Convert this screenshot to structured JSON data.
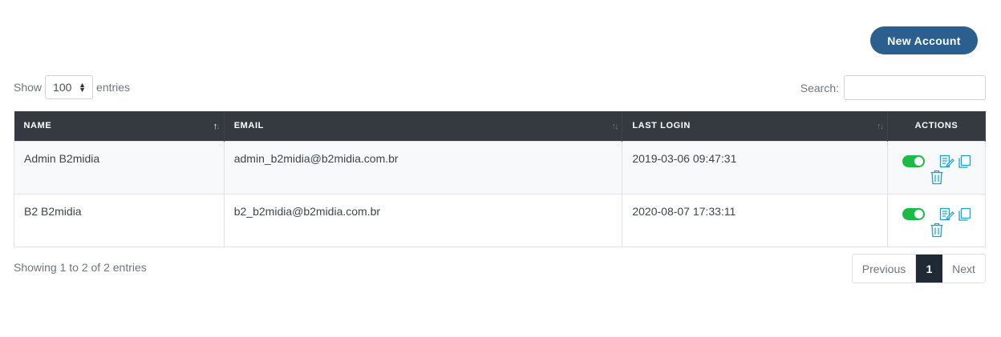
{
  "toolbar": {
    "new_account_label": "New Account"
  },
  "length": {
    "show_label": "Show",
    "value": "100",
    "entries_label": "entries"
  },
  "search": {
    "label": "Search:",
    "value": ""
  },
  "table": {
    "columns": [
      "NAME",
      "EMAIL",
      "LAST LOGIN",
      "ACTIONS"
    ],
    "rows": [
      {
        "name": "Admin B2midia",
        "email": "admin_b2midia@b2midia.com.br",
        "last_login": "2019-03-06 09:47:31",
        "active": true
      },
      {
        "name": "B2 B2midia",
        "email": "b2_b2midia@b2midia.com.br",
        "last_login": "2020-08-07 17:33:11",
        "active": true
      }
    ]
  },
  "footer": {
    "info": "Showing 1 to 2 of 2 entries",
    "previous": "Previous",
    "current_page": "1",
    "next": "Next"
  },
  "colors": {
    "primary": "#2b5f8f",
    "header": "#343a40",
    "toggle_on": "#1cbb46",
    "icon": "#17a2d0",
    "page_active": "#1f2a36"
  },
  "icons": [
    "sort-icon",
    "toggle-switch",
    "edit-icon",
    "copy-icon",
    "trash-icon"
  ]
}
